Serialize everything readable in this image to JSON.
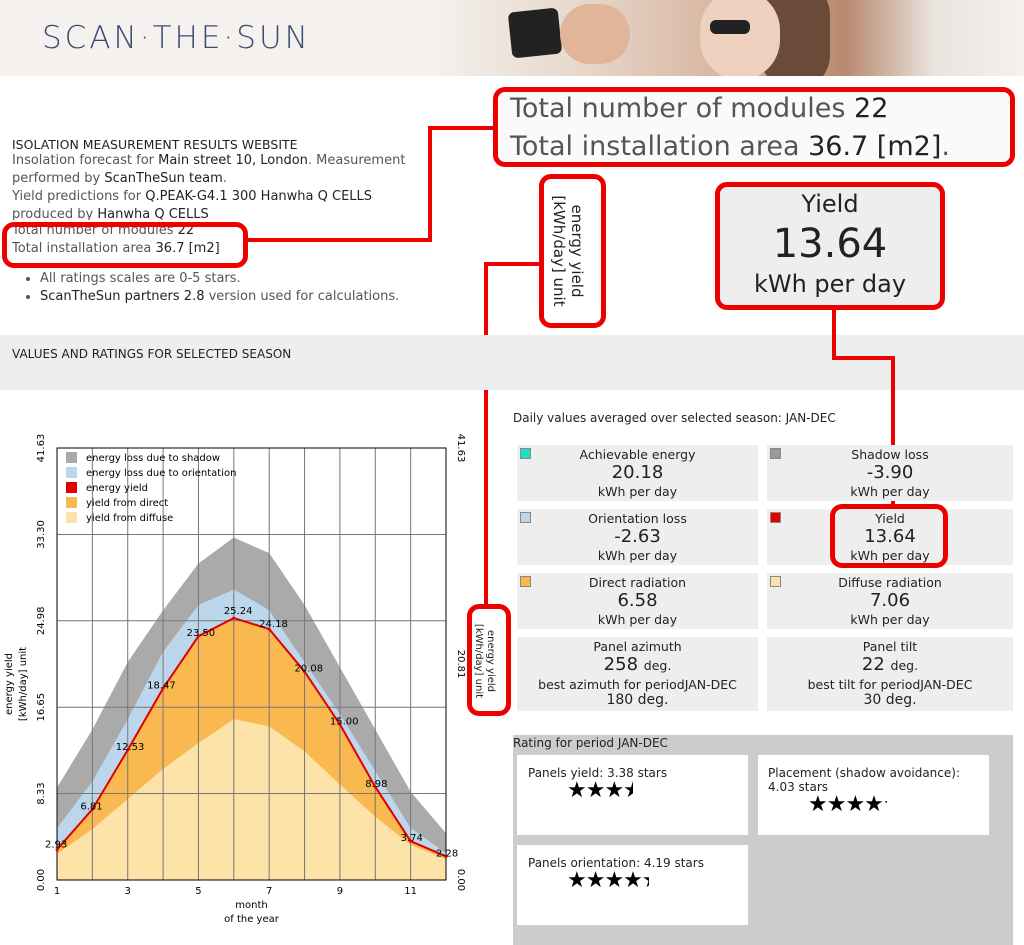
{
  "header": {
    "logo": "SCAN·THE·SUN"
  },
  "info": {
    "title": "ISOLATION MEASUREMENT RESULTS WEBSITE",
    "forecast_prefix": "Insolation forecast for ",
    "location": "Main street 10, London",
    "measure_prefix": ". Measurement",
    "performed_prefix": "performed by ",
    "team": "ScanTheSun team",
    "yield_prefix": "Yield predictions for ",
    "module": "Q.PEAK-G4.1 300 Hanwha Q CELLS",
    "produced_prefix": "produced by ",
    "producer": "Hanwha Q CELLS",
    "modules_label": "Total number of modules ",
    "modules_value": "22",
    "area_label": "Total installation area ",
    "area_value": "36.7  [m2]",
    "bullet1": "All ratings scales are 0-5 stars.",
    "bullet2_bold": "ScanTheSun partners 2.8",
    "bullet2_rest": " version used for calculations."
  },
  "callout_big": {
    "line1_label": "Total number of modules ",
    "line1_value": "22",
    "line2_label": "Total installation area ",
    "line2_value": "36.7  [m2]",
    "line2_end": "."
  },
  "callout_unit": {
    "line1": "energy yield",
    "line2": "[kWh/day] unit"
  },
  "callout_yield": {
    "label": "Yield",
    "value": "13.64",
    "unit": "kWh per day"
  },
  "section": {
    "title": "VALUES AND RATINGS FOR SELECTED SEASON",
    "daily_caption": "Daily values averaged over selected season: JAN-DEC"
  },
  "cells": [
    {
      "label": "Achievable energy",
      "value": "20.18",
      "unit": "kWh per day",
      "color": "#1de0c0"
    },
    {
      "label": "Shadow loss",
      "value": "-3.90",
      "unit": "kWh per day",
      "color": "#999999"
    },
    {
      "label": "Orientation loss",
      "value": "-2.63",
      "unit": "kWh per day",
      "color": "#bcd6ec"
    },
    {
      "label": "Yield",
      "value": "13.64",
      "unit": "kWh per day",
      "color": "#e00000"
    },
    {
      "label": "Direct radiation",
      "value": "6.58",
      "unit": "kWh per day",
      "color": "#f9b950"
    },
    {
      "label": "Diffuse radiation",
      "value": "7.06",
      "unit": "kWh per day",
      "color": "#fde3a8"
    }
  ],
  "azimuth": {
    "label": "Panel azimuth",
    "value": "258",
    "unit": "deg.",
    "best_label": "best azimuth for periodJAN-DEC",
    "best_value": "180 deg."
  },
  "tilt": {
    "label": "Panel tilt",
    "value": "22",
    "unit": "deg.",
    "best_label": "best tilt for periodJAN-DEC",
    "best_value": "30 deg."
  },
  "rating": {
    "title": "Rating for period JAN-DEC",
    "yield_label": "Panels yield: 3.38 stars",
    "yield_stars": 3.38,
    "placement_label": "Placement (shadow avoidance):",
    "placement_value": "4.03 stars",
    "placement_stars": 4.03,
    "orientation_label": "Panels orientation: 4.19 stars",
    "orientation_stars": 4.19
  },
  "chart_data": {
    "type": "area",
    "x": [
      1,
      2,
      3,
      4,
      5,
      6,
      7,
      8,
      9,
      10,
      11,
      12
    ],
    "x_ticks": [
      "1",
      "3",
      "5",
      "7",
      "9",
      "11"
    ],
    "xlabel_line1": "month",
    "xlabel_line2": "of the year",
    "ylabel_line1": "energy yield",
    "ylabel_line2": "[kWh/day] unit",
    "y_ticks": [
      "0.00",
      "8.33",
      "16.65",
      "24.98",
      "33.30",
      "41.63"
    ],
    "y_right_ticks": [
      "0.00",
      "20.81",
      "41.63"
    ],
    "ylim": [
      0,
      41.63
    ],
    "xlim": [
      1,
      12
    ],
    "grid": true,
    "legend_position": "top-left",
    "series": [
      {
        "name": "energy loss due to shadow",
        "color": "#aaaaaa",
        "values": [
          8.9,
          14.5,
          21.0,
          26.0,
          30.5,
          33.0,
          31.5,
          26.5,
          20.5,
          14.5,
          8.5,
          4.5
        ]
      },
      {
        "name": "energy loss due to orientation",
        "color": "#bcd6ec",
        "values": [
          5.0,
          9.5,
          15.5,
          22.0,
          26.5,
          28.0,
          26.0,
          21.0,
          16.0,
          10.5,
          5.0,
          2.6
        ]
      },
      {
        "name": "energy yield",
        "color": "#e00000",
        "values": [
          2.93,
          6.81,
          12.53,
          18.47,
          23.5,
          25.24,
          24.18,
          20.08,
          15.0,
          8.98,
          3.74,
          2.28
        ]
      },
      {
        "name": "yield from direct",
        "color": "#f9b950",
        "values": [
          2.93,
          6.81,
          12.53,
          18.47,
          23.5,
          25.24,
          24.18,
          20.08,
          15.0,
          8.98,
          3.74,
          2.28
        ]
      },
      {
        "name": "yield from diffuse",
        "color": "#fde3a8",
        "values": [
          2.5,
          4.9,
          7.8,
          10.7,
          13.2,
          15.5,
          14.8,
          12.4,
          9.2,
          6.1,
          3.4,
          2.0
        ]
      }
    ],
    "point_labels": [
      "2.93",
      "6.81",
      "12.53",
      "18.47",
      "23.50",
      "25.24",
      "24.18",
      "20.08",
      "15.00",
      "8.98",
      "3.74",
      "2.28"
    ]
  }
}
